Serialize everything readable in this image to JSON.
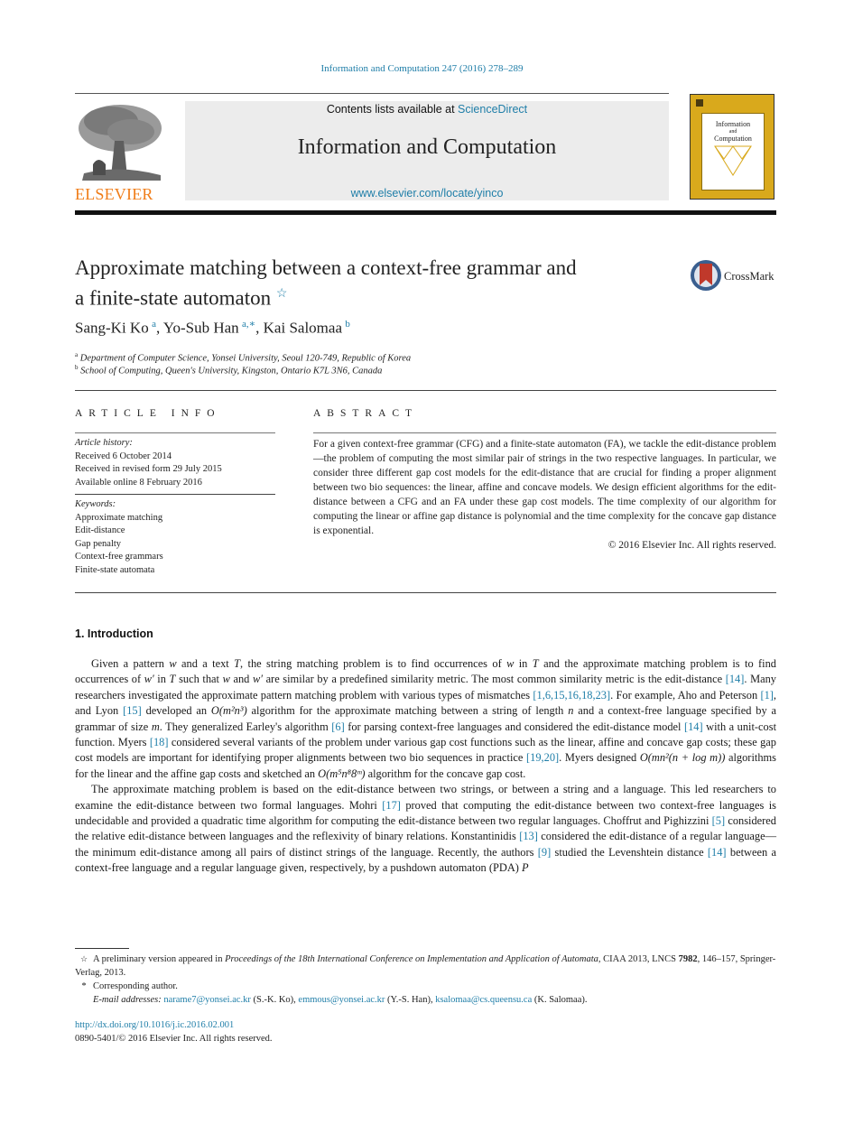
{
  "running_header": "Information and Computation 247 (2016) 278–289",
  "masthead": {
    "publisher_word": "ELSEVIER",
    "contents_prefix": "Contents lists available at ",
    "contents_link": "ScienceDirect",
    "journal_title": "Information and Computation",
    "journal_url": "www.elsevier.com/locate/yinco",
    "cover_title_line1": "Information",
    "cover_title_line2": "and",
    "cover_title_line3": "Computation",
    "cover_color": "#d9a91c",
    "publisher_color": "#f07d19"
  },
  "title": {
    "line1": "Approximate matching between a context-free grammar and",
    "line2": "a finite-state automaton",
    "title_note_mark": "☆",
    "crossmark_label": "CrossMark"
  },
  "authors": [
    {
      "name": "Sang-Ki Ko",
      "sup": "a"
    },
    {
      "name": "Yo-Sub Han",
      "sup": "a,∗"
    },
    {
      "name": "Kai Salomaa",
      "sup": "b"
    }
  ],
  "affiliations": [
    {
      "mark": "a",
      "text": "Department of Computer Science, Yonsei University, Seoul 120-749, Republic of Korea"
    },
    {
      "mark": "b",
      "text": "School of Computing, Queen's University, Kingston, Ontario K7L 3N6, Canada"
    }
  ],
  "article_info": {
    "heading": "ARTICLE INFO",
    "history_label": "Article history:",
    "history": [
      "Received 6 October 2014",
      "Received in revised form 29 July 2015",
      "Available online 8 February 2016"
    ],
    "keywords_label": "Keywords:",
    "keywords": [
      "Approximate matching",
      "Edit-distance",
      "Gap penalty",
      "Context-free grammars",
      "Finite-state automata"
    ]
  },
  "abstract": {
    "heading": "ABSTRACT",
    "text": "For a given context-free grammar (CFG) and a finite-state automaton (FA), we tackle the edit-distance problem—the problem of computing the most similar pair of strings in the two respective languages. In particular, we consider three different gap cost models for the edit-distance that are crucial for finding a proper alignment between two bio sequences: the linear, affine and concave models. We design efficient algorithms for the edit-distance between a CFG and an FA under these gap cost models. The time complexity of our algorithm for computing the linear or affine gap distance is polynomial and the time complexity for the concave gap distance is exponential.",
    "copyright": "© 2016 Elsevier Inc. All rights reserved."
  },
  "introduction": {
    "heading": "1. Introduction",
    "p1": {
      "t01": "Given a pattern ",
      "v_w": "w",
      "t02": " and a text ",
      "v_T": "T",
      "t03": ", the string matching problem is to find occurrences of ",
      "t04": " in ",
      "t05": " and the approximate matching problem is to find occurrences of ",
      "v_wp": "w′",
      "t06": " such that ",
      "t07": " and ",
      "t08": " are similar by a predefined similarity metric. The most common similarity metric is the edit-distance ",
      "c14": "[14]",
      "t09": ". Many researchers investigated the approximate pattern matching problem with various types of mismatches ",
      "c_multi": "[1,6,15,16,18,23]",
      "t10": ". For example, Aho and Peterson ",
      "c1": "[1]",
      "t11": ", and Lyon ",
      "c15": "[15]",
      "t12": " developed an ",
      "f1": "O(m²n³)",
      "t13": " algorithm for the approximate matching between a string of length ",
      "v_n": "n",
      "t14": " and a context-free language specified by a grammar of size ",
      "v_m": "m",
      "t15": ". They generalized Earley's algorithm ",
      "c6": "[6]",
      "t16": " for parsing context-free languages and considered the edit-distance model ",
      "t17": " with a unit-cost function. Myers ",
      "c18": "[18]",
      "t18": " considered several variants of the problem under various gap cost functions such as the linear, affine and concave gap costs; these gap cost models are important for identifying proper alignments between two bio sequences in practice ",
      "c1920": "[19,20]",
      "t19": ". Myers designed ",
      "f2": "O(mn²(n + log m))",
      "t20": " algorithms for the linear and the affine gap costs and sketched an ",
      "f3": "O(m⁵n⁸8ᵐ)",
      "t21": " algorithm for the concave gap cost."
    },
    "p2": {
      "t01": "The approximate matching problem is based on the edit-distance between two strings, or between a string and a language. This led researchers to examine the edit-distance between two formal languages. Mohri ",
      "c17": "[17]",
      "t02": " proved that computing the edit-distance between two context-free languages is undecidable and provided a quadratic time algorithm for computing the edit-distance between two regular languages. Choffrut and Pighizzini ",
      "c5": "[5]",
      "t03": " considered the relative edit-distance between languages and the reflexivity of binary relations. Konstantinidis ",
      "c13": "[13]",
      "t04": " considered the edit-distance of a regular language—the minimum edit-distance among all pairs of distinct strings of the language. Recently, the authors ",
      "c9": "[9]",
      "t05": " studied the Levenshtein distance ",
      "c14": "[14]",
      "t06": " between a context-free language and a regular language given, respectively, by a pushdown automaton (PDA) ",
      "v_P": "P"
    }
  },
  "footnotes": {
    "star_mark": "☆",
    "star_prefix": "A preliminary version appeared in ",
    "star_venue": "Proceedings of the 18th International Conference on Implementation and Application of Automata",
    "star_mid": ", CIAA 2013, LNCS ",
    "star_volume": "7982",
    "star_tail": ", 146–157, Springer-Verlag, 2013.",
    "corr_mark": "*",
    "corr_text": "Corresponding author.",
    "email_label": "E-mail addresses: ",
    "emails": [
      {
        "addr": "narame7@yonsei.ac.kr",
        "who": " (S.-K. Ko), "
      },
      {
        "addr": "emmous@yonsei.ac.kr",
        "who": " (Y.-S. Han), "
      },
      {
        "addr": "ksalomaa@cs.queensu.ca",
        "who": " (K. Salomaa)."
      }
    ]
  },
  "doi": {
    "link": "http://dx.doi.org/10.1016/j.ic.2016.02.001",
    "issn_line": "0890-5401/© 2016 Elsevier Inc. All rights reserved."
  },
  "link_color": "#1f7ea8"
}
